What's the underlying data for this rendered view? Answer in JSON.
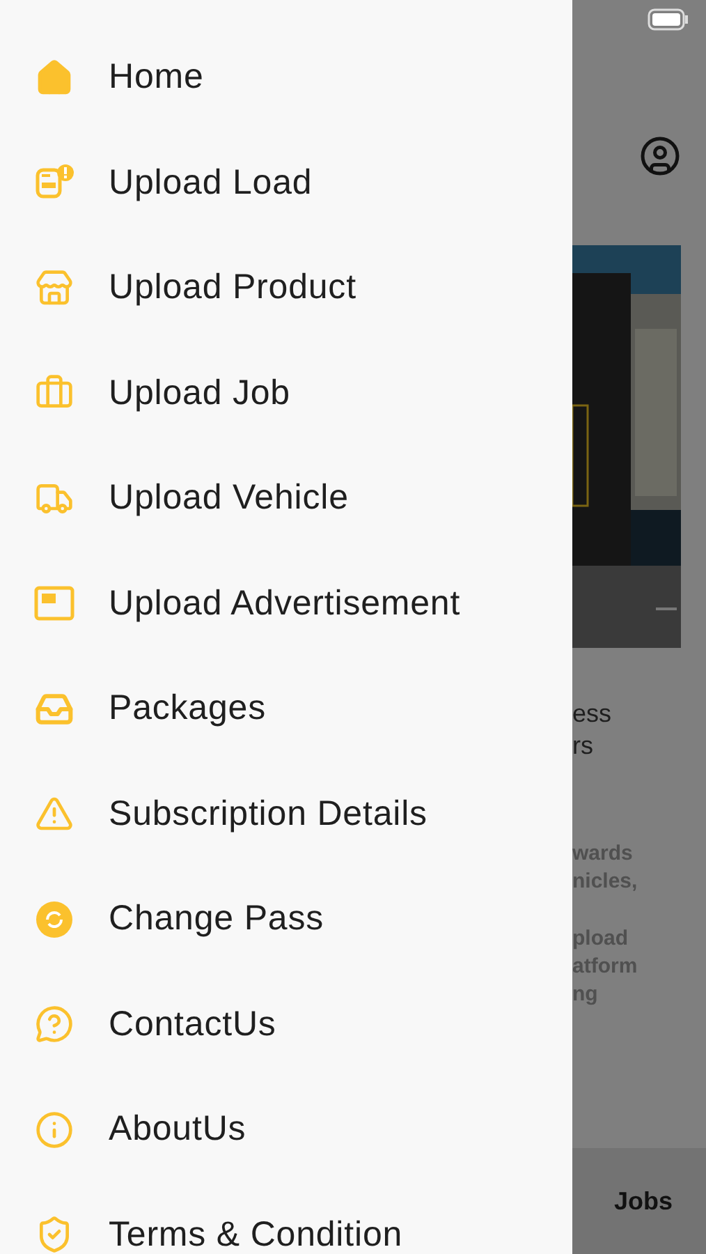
{
  "drawer": {
    "items": [
      {
        "label": "Home"
      },
      {
        "label": "Upload Load"
      },
      {
        "label": "Upload Product"
      },
      {
        "label": "Upload Job"
      },
      {
        "label": "Upload Vehicle"
      },
      {
        "label": "Upload Advertisement"
      },
      {
        "label": "Packages"
      },
      {
        "label": "Subscription Details"
      },
      {
        "label": "Change Pass"
      },
      {
        "label": "ContactUs"
      },
      {
        "label": "AboutUs"
      },
      {
        "label": "Terms & Condition"
      }
    ]
  },
  "background_page": {
    "headline_lines": [
      "ess",
      "rs"
    ],
    "body_lines": [
      "wards",
      "nicles,",
      "pload",
      "atform",
      "ng"
    ],
    "bottom_tab": {
      "label": "Jobs"
    }
  }
}
